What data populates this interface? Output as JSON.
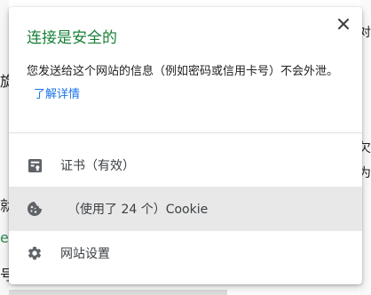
{
  "background": {
    "left_fragments": [
      "旋",
      "就",
      "es",
      "号"
    ],
    "right_fragments": [
      "对",
      "",
      "",
      "",
      "欠",
      "为",
      "",
      "",
      "",
      ""
    ]
  },
  "popup": {
    "title": "连接是安全的",
    "description": "您发送给这个网站的信息（例如密码或信用卡号）不会外泄。",
    "learn_more": "了解详情",
    "close_glyph": "✕",
    "items": [
      {
        "label": "证书（有效）",
        "icon": "certificate-icon"
      },
      {
        "label": "（使用了 24 个）Cookie",
        "icon": "cookie-icon"
      },
      {
        "label": "网站设置",
        "icon": "gear-icon"
      }
    ]
  },
  "colors": {
    "title_green": "#188038",
    "link_blue": "#1a73e8",
    "icon_gray": "#5f6368",
    "hover_row": "#e8e8e8"
  }
}
